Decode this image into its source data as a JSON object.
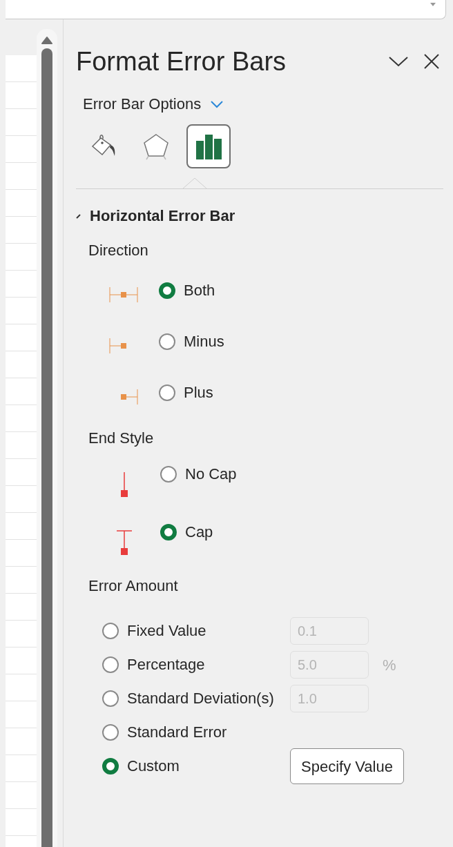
{
  "pane": {
    "title": "Format Error Bars",
    "options_menu": "Error Bar Options"
  },
  "tabs": [
    {
      "kind": "fill",
      "selected": false
    },
    {
      "kind": "effects",
      "selected": false
    },
    {
      "kind": "options",
      "selected": true
    }
  ],
  "section": {
    "title": "Horizontal Error Bar",
    "expanded": true
  },
  "direction": {
    "label": "Direction",
    "options": [
      {
        "kind": "both",
        "label": "Both",
        "selected": true
      },
      {
        "kind": "minus",
        "label": "Minus",
        "selected": false
      },
      {
        "kind": "plus",
        "label": "Plus",
        "selected": false
      }
    ]
  },
  "end_style": {
    "label": "End Style",
    "options": [
      {
        "kind": "nocap",
        "label": "No Cap",
        "selected": false
      },
      {
        "kind": "cap",
        "label": "Cap",
        "selected": true
      }
    ]
  },
  "error_amount": {
    "label": "Error Amount",
    "options": [
      {
        "label": "Fixed Value",
        "selected": false,
        "field": {
          "value": "0.1",
          "disabled": true
        }
      },
      {
        "label": "Percentage",
        "selected": false,
        "field": {
          "value": "5.0",
          "disabled": true
        },
        "unit": "%"
      },
      {
        "label": "Standard Deviation(s)",
        "selected": false,
        "field": {
          "value": "1.0",
          "disabled": true
        }
      },
      {
        "label": "Standard Error",
        "selected": false
      },
      {
        "label": "Custom",
        "selected": true,
        "button": "Specify Value"
      }
    ]
  }
}
